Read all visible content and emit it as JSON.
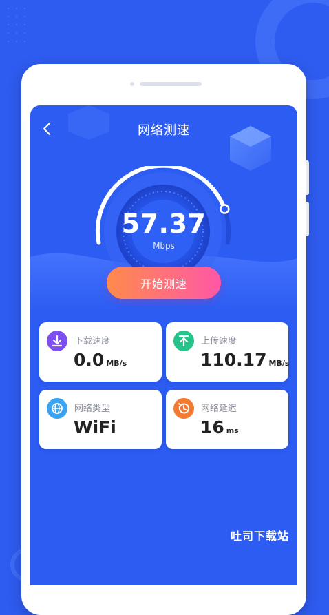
{
  "header": {
    "title": "网络测速"
  },
  "speed": {
    "value": "57.37",
    "unit": "Mbps",
    "gauge_fraction": 0.85
  },
  "start_button": {
    "label": "开始测速"
  },
  "stats": [
    {
      "label": "下载速度",
      "value": "0.0",
      "unit": "MB/s",
      "icon": "download-icon",
      "color": "#7d4ef0"
    },
    {
      "label": "上传速度",
      "value": "110.17",
      "unit": "MB/s",
      "icon": "upload-icon",
      "color": "#25c48a"
    },
    {
      "label": "网络类型",
      "value": "WiFi",
      "unit": "",
      "icon": "globe-icon",
      "color": "#3aa3f3"
    },
    {
      "label": "网络延迟",
      "value": "16",
      "unit": "ms",
      "icon": "history-icon",
      "color": "#f27a33"
    }
  ],
  "watermark": "吐司下载站",
  "colors": {
    "background": "#2f5cf0",
    "accent": "#ff6f7e"
  }
}
